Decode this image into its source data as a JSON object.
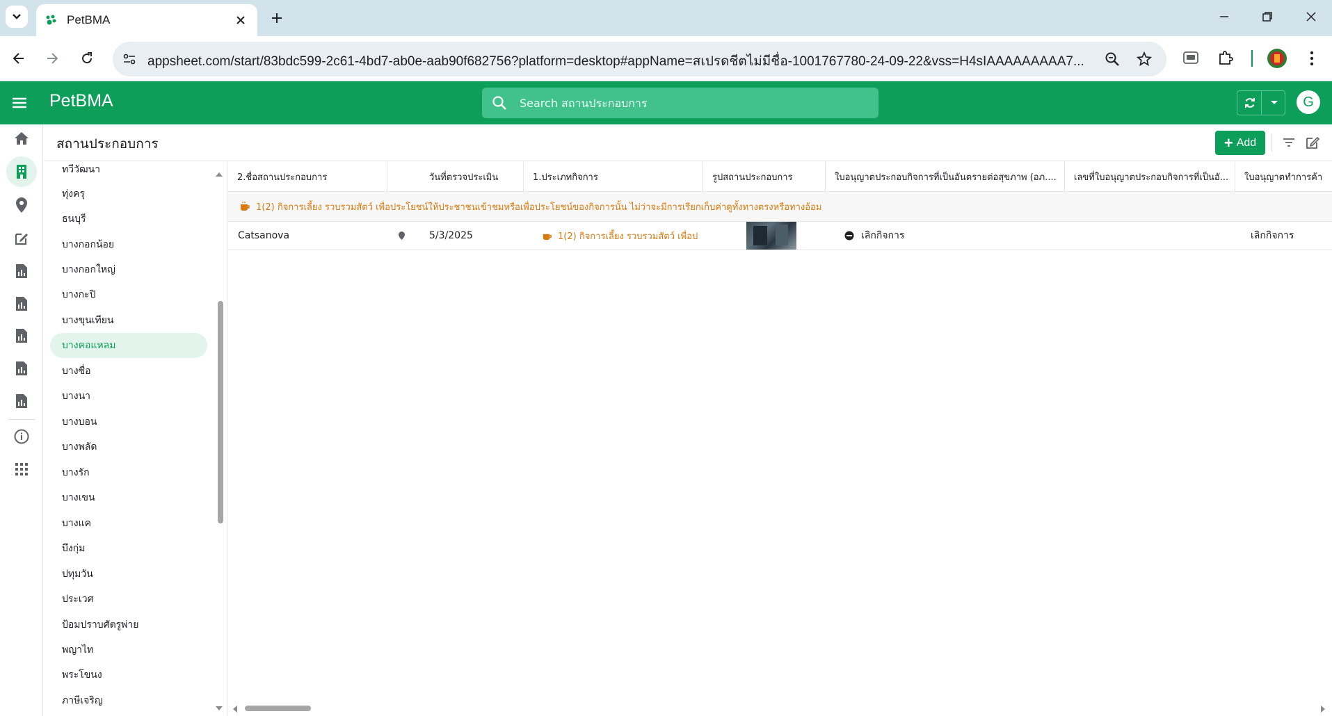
{
  "browser": {
    "tab_title": "PetBMA",
    "url": "appsheet.com/start/83bdc599-2c61-4bd7-ab0e-aab90f682756?platform=desktop#appName=สเปรดชีตไม่มีชื่อ-1001767780-24-09-22&vss=H4sIAAAAAAAAA7...",
    "icons": [
      "tab-list-icon",
      "close-icon",
      "plus-icon",
      "minimize-icon",
      "restore-icon",
      "close-window-icon",
      "back-arrow-icon",
      "forward-arrow-icon",
      "reload-icon",
      "site-info-icon",
      "zoom-icon",
      "star-icon",
      "extension-icon",
      "puzzle-icon",
      "profile-icon",
      "kebab-menu-icon"
    ]
  },
  "app": {
    "title": "PetBMA",
    "search_placeholder": "Search สถานประกอบการ",
    "avatar_letter": "G",
    "accent_color": "#0d9f5a"
  },
  "rail": {
    "items": [
      "home-icon",
      "building-icon",
      "map-pin-icon",
      "edit-icon",
      "report-icon",
      "report-icon",
      "report-icon",
      "report-icon",
      "report-icon",
      "info-icon",
      "apps-grid-icon"
    ],
    "active_index": 1
  },
  "page": {
    "title": "สถานประกอบการ",
    "add_label": "Add"
  },
  "groups": {
    "items": [
      "ทวีวัฒนา",
      "ทุ่งครุ",
      "ธนบุรี",
      "บางกอกน้อย",
      "บางกอกใหญ่",
      "บางกะปิ",
      "บางขุนเทียน",
      "บางคอแหลม",
      "บางซื่อ",
      "บางนา",
      "บางบอน",
      "บางพลัด",
      "บางรัก",
      "บางเขน",
      "บางแค",
      "บึงกุ่ม",
      "ปทุมวัน",
      "ประเวศ",
      "ป้อมปราบศัตรูพ่าย",
      "พญาไท",
      "พระโขนง",
      "ภาษีเจริญ"
    ],
    "selected": "บางคอแหลม"
  },
  "table": {
    "columns": [
      "2.ชื่อสถานประกอบการ",
      "วันที่ตรวจประเมิน",
      "1.ประเภทกิจการ",
      "รูปสถานประกอบการ",
      "ใบอนุญาตประกอบกิจการที่เป็นอันตรายต่อสุขภาพ (อภ....",
      "เลขที่ใบอนุญาตประกอบกิจการที่เป็นอั...",
      "ใบอนุญาตทำการค้า"
    ],
    "group_header": "1(2) กิจการเลี้ยง รวบรวมสัตว์ เพื่อประโยชน์ให้ประชาชนเข้าชมหรือเพื่อประโยชน์ของกิจการนั้น ไม่ว่าจะมีการเรียกเก็บค่าดูทั้งทางตรงหรือทางอ้อม",
    "rows": [
      {
        "name": "Catsanova",
        "date": "5/3/2025",
        "type": "1(2) กิจการเลี้ยง รวบรวมสัตว์ เพื่อป...",
        "license_status": "เลิกกิจการ",
        "trade_license": "เลิกกิจการ"
      }
    ]
  }
}
